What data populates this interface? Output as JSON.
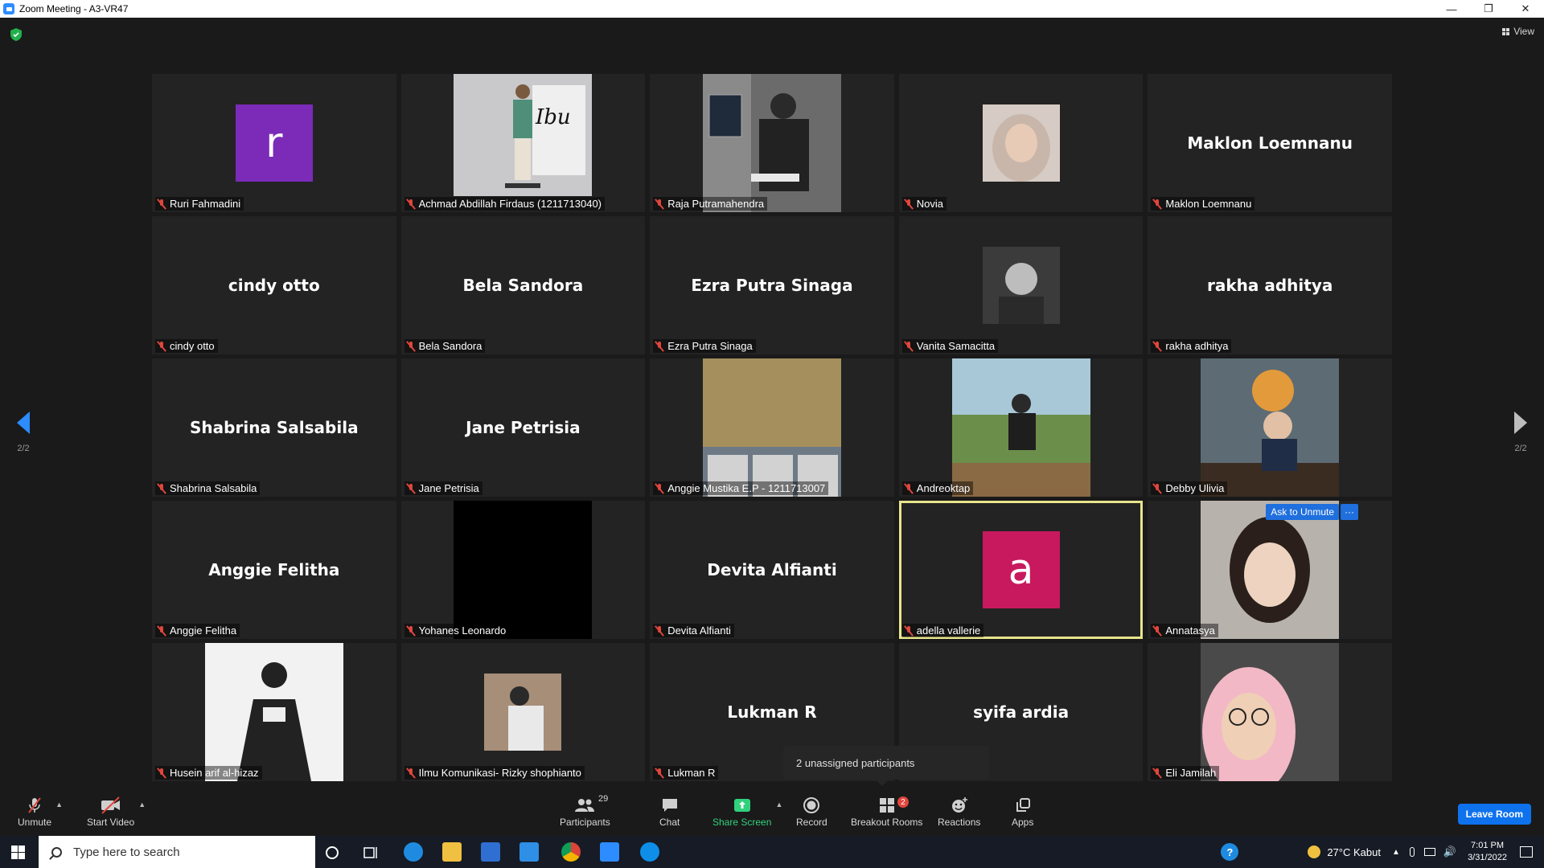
{
  "window": {
    "title": "Zoom Meeting - A3-VR47",
    "minimize": "—",
    "restore": "❐",
    "close": "✕"
  },
  "header": {
    "view_label": "View"
  },
  "pager": {
    "left": "2/2",
    "right": "2/2"
  },
  "colors": {
    "accent": "#2d8cff",
    "active_speaker": "#e8e58c",
    "mute": "#e0463d",
    "leave": "#0e72ed"
  },
  "tiles": [
    {
      "name": "Ruri Fahmadini",
      "type": "letter",
      "letter": "r",
      "color": "#7b2bb8"
    },
    {
      "name": "Achmad Abdillah Firdaus (1211713040)",
      "type": "photo",
      "image": "person-standing-poster",
      "poster_text": "Ibu"
    },
    {
      "name": "Raja Putramahendra",
      "type": "photo",
      "image": "person-writing-masked"
    },
    {
      "name": "Novia",
      "type": "photo-small",
      "image": "woman-hijab"
    },
    {
      "name": "Maklon Loemnanu",
      "type": "text",
      "display": "Maklon Loemnanu"
    },
    {
      "name": "cindy otto",
      "type": "text",
      "display": "cindy otto"
    },
    {
      "name": "Bela Sandora",
      "type": "text",
      "display": "Bela Sandora"
    },
    {
      "name": "Ezra Putra Sinaga",
      "type": "text",
      "display": "Ezra Putra Sinaga"
    },
    {
      "name": "Vanita Samacitta",
      "type": "photo-small",
      "image": "man-portrait-bw"
    },
    {
      "name": "rakha adhitya",
      "type": "text",
      "display": "rakha adhitya"
    },
    {
      "name": "Shabrina Salsabila",
      "type": "text",
      "display": "Shabrina Salsabila"
    },
    {
      "name": "Jane Petrisia",
      "type": "text",
      "display": "Jane Petrisia"
    },
    {
      "name": "Anggie Mustika E.P - 1211713007",
      "type": "photo",
      "image": "room-with-portraits"
    },
    {
      "name": "Andreoktap",
      "type": "photo",
      "image": "person-sitting-outdoors"
    },
    {
      "name": "Debby Ulivia",
      "type": "photo",
      "image": "woman-cafe"
    },
    {
      "name": "Anggie Felitha",
      "type": "text",
      "display": "Anggie Felitha"
    },
    {
      "name": "Yohanes Leonardo",
      "type": "photo",
      "image": "black-video"
    },
    {
      "name": "Devita Alfianti",
      "type": "text",
      "display": "Devita Alfianti"
    },
    {
      "name": "adella vallerie",
      "type": "letter",
      "letter": "a",
      "color": "#c8195e",
      "active": true
    },
    {
      "name": "Annatasya",
      "type": "photo",
      "image": "woman-selfie",
      "ask_unmute": "Ask to Unmute",
      "more": "···"
    },
    {
      "name": "Husein arif al-hizaz",
      "type": "photo",
      "image": "anime-drawing"
    },
    {
      "name": "Ilmu Komunikasi- Rizky shophianto",
      "type": "photo-small",
      "image": "man-outdoors"
    },
    {
      "name": "Lukman R",
      "type": "text",
      "display": "Lukman R"
    },
    {
      "name": "syifa ardia",
      "type": "text",
      "display": "syifa ardia",
      "no_label": true
    },
    {
      "name": "Eli Jamilah",
      "type": "photo",
      "image": "woman-pink-hijab-glasses"
    }
  ],
  "tooltip": {
    "text": "2 unassigned participants"
  },
  "toolbar": {
    "unmute": "Unmute",
    "start_video": "Start Video",
    "participants": "Participants",
    "participants_count": "29",
    "chat": "Chat",
    "share_screen": "Share Screen",
    "record": "Record",
    "breakout_rooms": "Breakout Rooms",
    "breakout_badge": "2",
    "reactions": "Reactions",
    "apps": "Apps",
    "leave_room": "Leave Room"
  },
  "taskbar": {
    "search_placeholder": "Type here to search",
    "weather": "27°C  Kabut",
    "time": "7:01 PM",
    "date": "3/31/2022"
  }
}
